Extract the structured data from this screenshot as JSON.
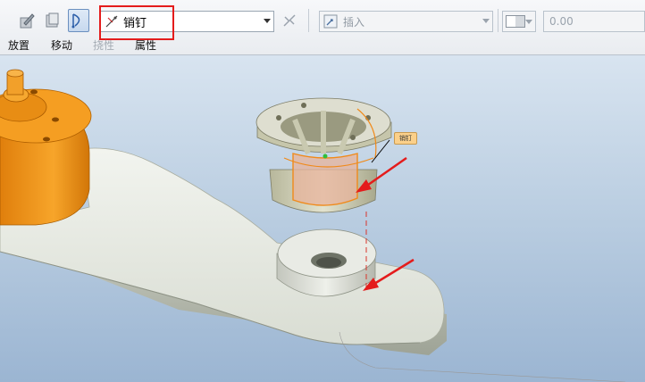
{
  "toolbar": {
    "constraint_select": {
      "value": "销钉",
      "icon": "pin-constraint-icon"
    },
    "insert_select": {
      "value": "插入",
      "icon": "insert-reference-icon"
    },
    "offset_input": {
      "placeholder": "0.00"
    }
  },
  "tabs": [
    {
      "label": "放置",
      "enabled": true
    },
    {
      "label": "移动",
      "enabled": true
    },
    {
      "label": "挠性",
      "enabled": false
    },
    {
      "label": "属性",
      "enabled": true
    }
  ],
  "viewport": {
    "callout_label": "销钉",
    "highlight_color": "#e41c1c",
    "arrow_color": "#e41c1c",
    "part_colors": {
      "hub": "#f39a1a",
      "arm": "#e8ebe3",
      "bushing": "#d7d7bf",
      "selection": "#f08a1a"
    }
  }
}
